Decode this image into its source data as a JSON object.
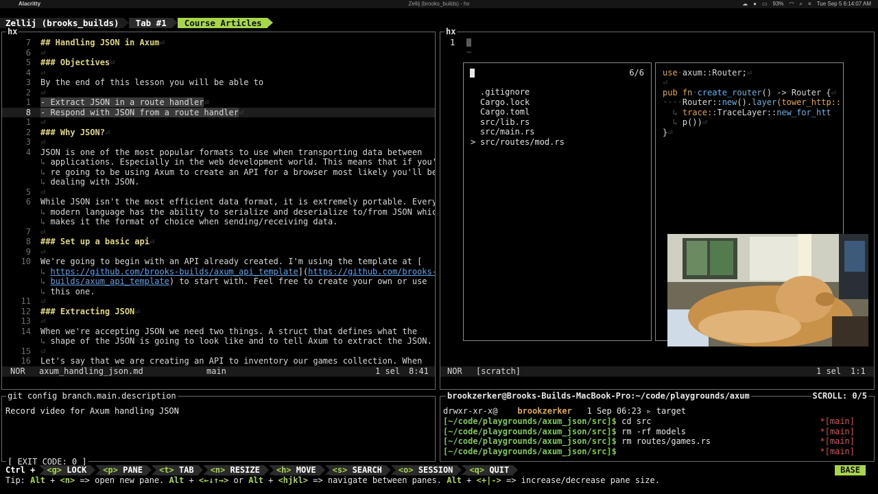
{
  "menubar": {
    "app_name": "Alacritty",
    "window_title": "Zellij (brooks_builds) - hx",
    "battery": "93%",
    "datetime": "Tue Sep 5  6:14:07 AM"
  },
  "tabbar": {
    "session": "Zellij (brooks_builds)",
    "tabs": [
      {
        "label": "Tab #1",
        "active": false
      },
      {
        "label": "Course Articles",
        "active": true
      }
    ]
  },
  "left_pane": {
    "title": "hx",
    "lines": [
      {
        "num": "7",
        "text": "## Handling JSON in Axum",
        "type": "head"
      },
      {
        "num": "6",
        "text": "",
        "type": "blank"
      },
      {
        "num": "5",
        "text": "### Objectives",
        "type": "head"
      },
      {
        "num": "4",
        "text": "",
        "type": "blank"
      },
      {
        "num": "3",
        "text": "By the end of this lesson you will be able to",
        "type": "text"
      },
      {
        "num": "2",
        "text": "",
        "type": "blank"
      },
      {
        "num": "1",
        "text": "- Extract JSON in a route handler",
        "type": "sel"
      },
      {
        "num": "8",
        "text": "- Respond with JSON from a route handler",
        "type": "selcur"
      },
      {
        "num": "1",
        "text": "",
        "type": "blank"
      },
      {
        "num": "2",
        "text": "### Why JSON?",
        "type": "head"
      },
      {
        "num": "3",
        "text": "",
        "type": "blank"
      },
      {
        "num": "4",
        "text": "JSON is one of the most popular formats to use when transporting data between",
        "type": "text"
      },
      {
        "num": "",
        "text": "applications. Especially in the web development world. This means that if you'",
        "type": "wrap"
      },
      {
        "num": "",
        "text": "re going to be using Axum to create an API for a browser most likely you'll be",
        "type": "wrap"
      },
      {
        "num": "",
        "text": "dealing with JSON.",
        "type": "wrap"
      },
      {
        "num": "5",
        "text": "",
        "type": "blank"
      },
      {
        "num": "6",
        "text": "While JSON isn't the most efficient data format, it is extremely portable. Every",
        "type": "text"
      },
      {
        "num": "",
        "text": "modern language has the ability to serialize and deserialize to/from JSON which",
        "type": "wrap"
      },
      {
        "num": "",
        "text": "makes it the format of choice when sending/receiving data.",
        "type": "wrap"
      },
      {
        "num": "7",
        "text": "",
        "type": "blank"
      },
      {
        "num": "8",
        "text": "### Set up a basic api",
        "type": "head"
      },
      {
        "num": "9",
        "text": "",
        "type": "blank"
      },
      {
        "num": "10",
        "text": "We're going to begin with an API already created. I'm using the template at [",
        "type": "text"
      },
      {
        "num": "",
        "text": "https://github.com/brooks-builds/axum_api_template](https://github.com/brooks-",
        "type": "wraplink"
      },
      {
        "num": "",
        "text": "builds/axum_api_template) to start with. Feel free to create your own or use",
        "type": "wraplink2"
      },
      {
        "num": "",
        "text": "this one.",
        "type": "wrap"
      },
      {
        "num": "11",
        "text": "",
        "type": "blank"
      },
      {
        "num": "12",
        "text": "### Extracting JSON",
        "type": "head"
      },
      {
        "num": "13",
        "text": "",
        "type": "blank"
      },
      {
        "num": "14",
        "text": "When we're accepting JSON we need two things. A struct that defines what the",
        "type": "text"
      },
      {
        "num": "",
        "text": "shape of the JSON is going to look like and to tell Axum to extract the JSON.",
        "type": "wrap"
      },
      {
        "num": "15",
        "text": "",
        "type": "blank"
      },
      {
        "num": "16",
        "text": "Let's say that we are creating an API to inventory our games collection. When",
        "type": "text"
      }
    ],
    "status": {
      "mode": "NOR",
      "file": "axum_handling_json.md",
      "branch": "main",
      "sel": "1 sel",
      "pos": "8:41"
    }
  },
  "right_pane": {
    "title": "hx",
    "line_num": "1",
    "status": {
      "mode": "NOR",
      "file": "[scratch]",
      "sel": "1 sel",
      "pos": "1:1"
    },
    "picker": {
      "count": "6/6",
      "items": [
        ".gitignore",
        "Cargo.lock",
        "Cargo.toml",
        "src/lib.rs",
        "src/main.rs",
        "src/routes/mod.rs"
      ],
      "selected_index": 5
    },
    "preview": {
      "line1_kw": "use",
      "line1_rest": "axum::Router;",
      "line3_kw": "pub fn",
      "line3_fn": "create_router",
      "line3_rest": "() -> Router {",
      "line4_a": "Router::",
      "line4_b": "new",
      "line4_c": "().",
      "line4_d": "layer",
      "line4_e": "(tower_http::",
      "line5_a": "trace::",
      "line5_b": "TraceLayer::",
      "line5_c": "new_for_htt",
      "line6": "p())",
      "line7": "}"
    }
  },
  "git_pane": {
    "title": "git config branch.main.description",
    "text": "Record video for Axum handling JSON",
    "exit_code": "[ EXIT CODE: 0 ]"
  },
  "term_pane": {
    "title": "brookzerker@Brooks-Builds-MacBook-Pro:~/code/playgrounds/axum",
    "scroll": "SCROLL:  0/5",
    "line0_perm": "drwxr-xr-x@",
    "line0_user": "brookzerker",
    "line0_date": "1 Sep 06:23",
    "line0_target": "target",
    "lines": [
      {
        "prompt": "[~/code/playgrounds/axum_json/src]$",
        "cmd": "cd src",
        "branch": "*[main]"
      },
      {
        "prompt": "[~/code/playgrounds/axum_json/src]$",
        "cmd": "rm -rf models",
        "branch": "*[main]"
      },
      {
        "prompt": "[~/code/playgrounds/axum_json/src]$",
        "cmd": "rm routes/games.rs",
        "branch": "*[main]"
      },
      {
        "prompt": "[~/code/playgrounds/axum_json/src]$",
        "cmd": "",
        "branch": "*[main]"
      }
    ]
  },
  "keybar": {
    "ctrl_label": "Ctrl +",
    "items": [
      {
        "key": "<g>",
        "label": "LOCK"
      },
      {
        "key": "<p>",
        "label": "PANE"
      },
      {
        "key": "<t>",
        "label": "TAB"
      },
      {
        "key": "<n>",
        "label": "RESIZE"
      },
      {
        "key": "<h>",
        "label": "MOVE"
      },
      {
        "key": "<s>",
        "label": "SEARCH"
      },
      {
        "key": "<o>",
        "label": "SESSION"
      },
      {
        "key": "<q>",
        "label": "QUIT"
      }
    ],
    "mode": "BASE"
  },
  "tip": {
    "prefix": "Tip:",
    "k1": "Alt",
    "t1": "+",
    "k2": "<n>",
    "t2": "=> open new pane.",
    "k3": "Alt",
    "t3": "+",
    "k4": "<←↓↑→>",
    "t4": "or",
    "k5": "Alt",
    "t5": "+",
    "k6": "<hjkl>",
    "t6": "=> navigate between panes.",
    "k7": "Alt",
    "t7": "+",
    "k8": "<+|->",
    "t8": "=> increase/decrease pane size."
  }
}
